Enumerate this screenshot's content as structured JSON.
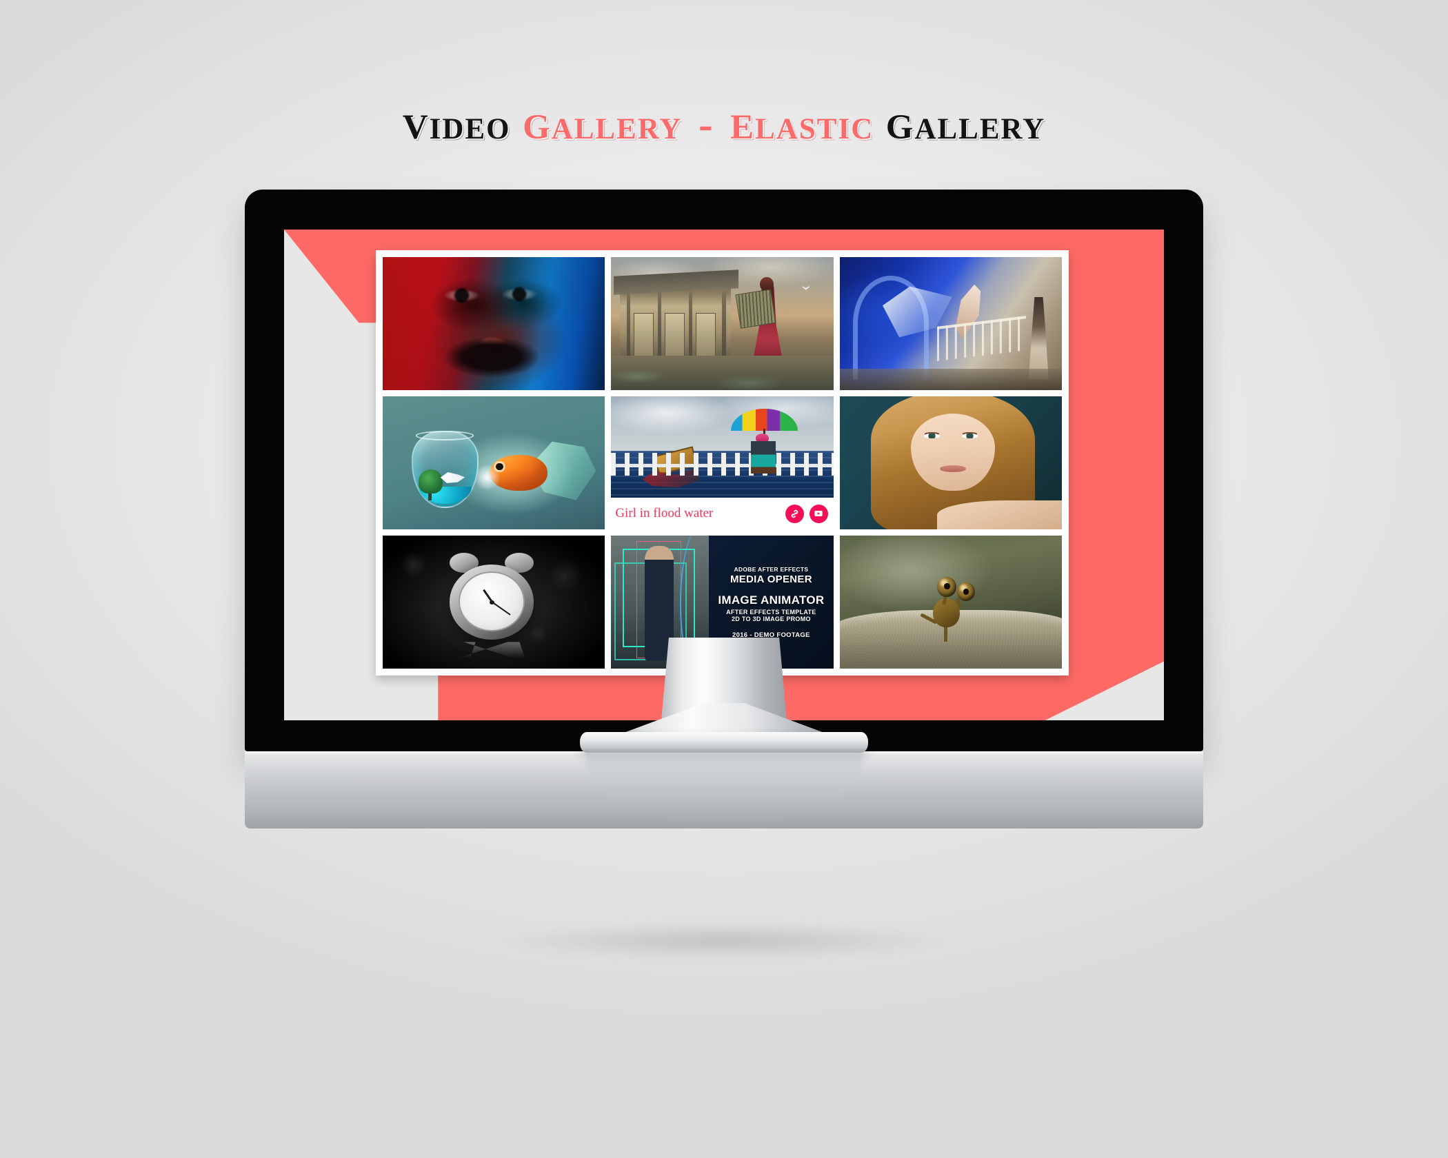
{
  "title": {
    "full": "VIDEO GALLERY - ELASTIC GALLERY",
    "word1": "Video",
    "word2": "Gallery",
    "separator": "-",
    "word3": "Elastic",
    "word4": "Gallery",
    "color_dark": "#111315",
    "color_accent": "#fb6a6a"
  },
  "theme": {
    "accent": "#fd6a66",
    "bezel": "#050505",
    "screen_bg": "#e7e7e5",
    "card_bg": "#ffffff",
    "caption_text_color": "#f8365a",
    "caption_button_bg": "#f50f56"
  },
  "gallery": {
    "name": "Elastic Gallery",
    "columns": 3,
    "rows": 3,
    "items": [
      {
        "index": 1,
        "alt": "Man portrait lit with red and blue gels",
        "art": "art-portrait-rb",
        "caption": null
      },
      {
        "index": 2,
        "alt": "Woman holding panel in front of abandoned house",
        "art": "art-house",
        "caption": null
      },
      {
        "index": 3,
        "alt": "Blue archway with flowing veil and dancer",
        "art": "art-arch",
        "caption": null
      },
      {
        "index": 4,
        "alt": "Goldfish and fishbowl surreal composite",
        "art": "art-fish",
        "caption": null
      },
      {
        "index": 5,
        "alt": "Girl with rainbow umbrella in flood water",
        "art": "art-flood",
        "caption": "Girl in flood water"
      },
      {
        "index": 6,
        "alt": "Blonde woman portrait",
        "art": "art-blonde",
        "caption": null
      },
      {
        "index": 7,
        "alt": "Black and white alarm clock",
        "art": "art-clock",
        "caption": null
      },
      {
        "index": 8,
        "alt": "Adobe After Effects Media Opener template card",
        "art": "art-opener",
        "caption": null
      },
      {
        "index": 9,
        "alt": "Clay creature with big eyes on a ledge",
        "art": "art-creature",
        "caption": null
      }
    ]
  },
  "caption": {
    "text": "Girl in flood water",
    "buttons": [
      {
        "name": "link-icon",
        "title": "Permalink"
      },
      {
        "name": "play-icon",
        "title": "Play video"
      }
    ]
  },
  "media_opener_card": {
    "line1": "ADOBE AFTER EFFECTS",
    "line2": "MEDIA OPENER",
    "line3": "IMAGE ANIMATOR",
    "line4": "AFTER EFFECTS TEMPLATE",
    "line5": "2D TO 3D IMAGE PROMO",
    "line6": "2016 - DEMO FOOTAGE"
  }
}
